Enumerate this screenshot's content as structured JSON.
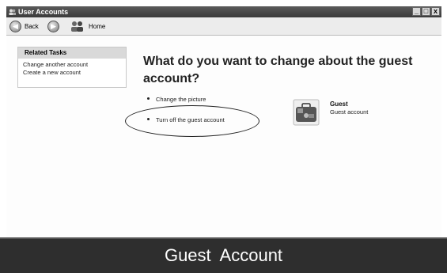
{
  "window": {
    "title": "User Accounts",
    "buttons": [
      "_",
      "□",
      "x"
    ]
  },
  "toolbar": {
    "back_label": "Back",
    "home_label": "Home"
  },
  "tasks": {
    "header": "Related Tasks",
    "items": [
      "Change another account",
      "Create a new account"
    ]
  },
  "main": {
    "headline": "What do you want to change about the guest account?",
    "options": [
      "Change the picture",
      "Turn off the guest account"
    ]
  },
  "guest": {
    "name": "Guest",
    "subtitle": "Guest account"
  },
  "caption": {
    "text": "Guest  Account"
  }
}
